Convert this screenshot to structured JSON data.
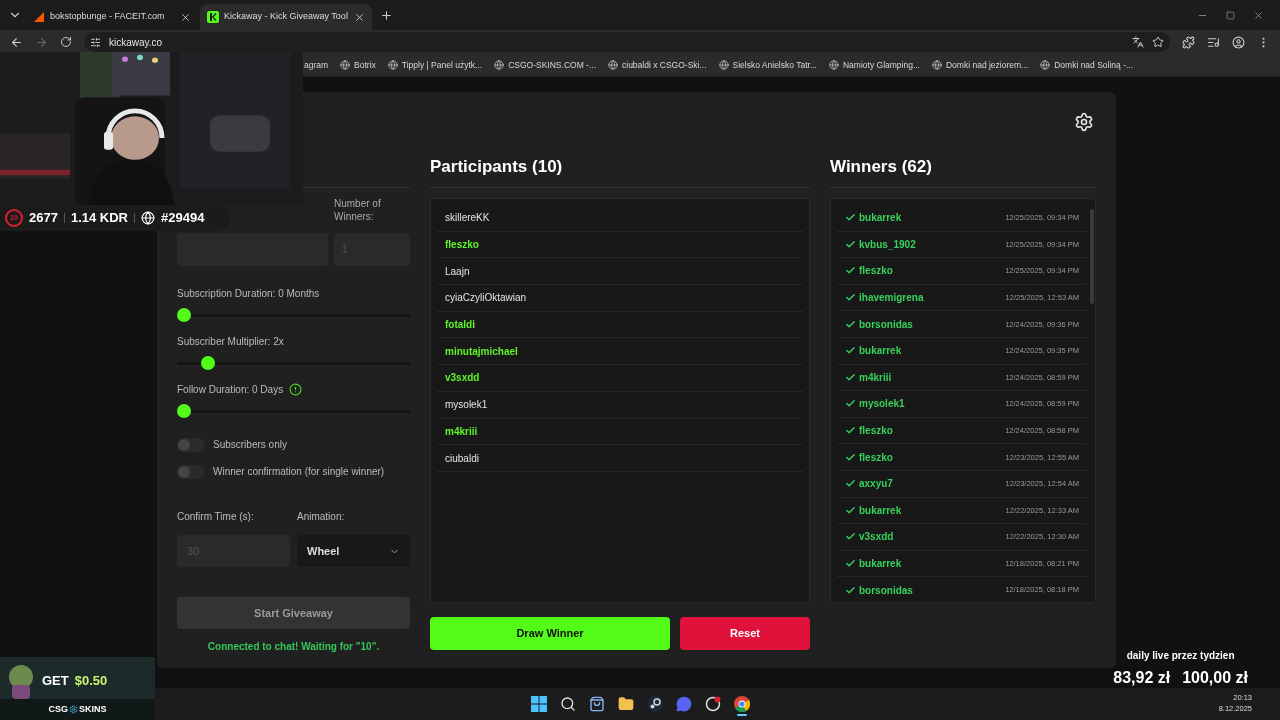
{
  "browser": {
    "tabs": [
      {
        "title": "bokstopbunge - FACEIT.com",
        "selected": false
      },
      {
        "title": "Kickaway - Kick Giveaway Tool",
        "selected": true
      }
    ],
    "url": "kickaway.co",
    "bookmarks": [
      "agram",
      "Botrix",
      "Tipply | Panel użytk...",
      "CSGO-SKINS.COM -...",
      "ciubaldi x CSGO-Ski...",
      "Sielsko Anielsko Tatr...",
      "Namioty Glamping...",
      "Domki nad jeziorem...",
      "Domki nad Soliną -..."
    ]
  },
  "settings": {
    "winners_label": "Number of Winners:",
    "winners_placeholder": "1",
    "sliders": [
      {
        "label": "Subscription Duration: 0 Months",
        "level": 0,
        "info": false
      },
      {
        "label": "Subscriber Multiplier: 2x",
        "level": 0.11,
        "info": false
      },
      {
        "label": "Follow Duration: 0 Days",
        "level": 0,
        "info": true
      }
    ],
    "toggles": [
      {
        "label": "Subscribers only",
        "on": false
      },
      {
        "label": "Winner confirmation (for single winner)",
        "on": false
      }
    ],
    "confirm_label": "Confirm Time (s):",
    "confirm_placeholder": "30",
    "animation_label": "Animation:",
    "animation_value": "Wheel",
    "start_button": {
      "label": "Start Giveaway",
      "disabled": true
    },
    "status": "Connected to chat! Waiting for \"10\"."
  },
  "participants": {
    "title": "Participants (10)",
    "items": [
      {
        "name": "skillereKK",
        "highlighted": false
      },
      {
        "name": "fleszko",
        "highlighted": true
      },
      {
        "name": "Laajn",
        "highlighted": false
      },
      {
        "name": "cyiaCzyliOktawian",
        "highlighted": false
      },
      {
        "name": "fotaldi",
        "highlighted": true
      },
      {
        "name": "minutajmichael",
        "highlighted": true
      },
      {
        "name": "v3sxdd",
        "highlighted": true
      },
      {
        "name": "mysolek1",
        "highlighted": false
      },
      {
        "name": "m4kriii",
        "highlighted": true
      },
      {
        "name": "ciubaldi",
        "highlighted": false
      }
    ]
  },
  "actions": {
    "draw": "Draw Winner",
    "reset": "Reset"
  },
  "winners": {
    "title": "Winners (62)",
    "items": [
      {
        "name": "bukarrek",
        "time": "12/25/2025, 09:34 PM"
      },
      {
        "name": "kvbus_1902",
        "time": "12/25/2025, 09:34 PM"
      },
      {
        "name": "fleszko",
        "time": "12/25/2025, 09:34 PM"
      },
      {
        "name": "ihavemigrena",
        "time": "12/25/2025, 12:53 AM"
      },
      {
        "name": "borsonidas",
        "time": "12/24/2025, 09:36 PM"
      },
      {
        "name": "bukarrek",
        "time": "12/24/2025, 09:35 PM"
      },
      {
        "name": "m4kriii",
        "time": "12/24/2025, 08:59 PM"
      },
      {
        "name": "mysolek1",
        "time": "12/24/2025, 08:59 PM"
      },
      {
        "name": "fleszko",
        "time": "12/24/2025, 08:58 PM"
      },
      {
        "name": "fleszko",
        "time": "12/23/2025, 12:55 AM"
      },
      {
        "name": "axxyu7",
        "time": "12/23/2025, 12:54 AM"
      },
      {
        "name": "bukarrek",
        "time": "12/22/2025, 12:33 AM"
      },
      {
        "name": "v3sxdd",
        "time": "12/22/2025, 12:30 AM"
      },
      {
        "name": "bukarrek",
        "time": "12/18/2025, 08:21 PM"
      },
      {
        "name": "borsonidas",
        "time": "12/18/2025, 08:18 PM"
      }
    ]
  },
  "stream_overlay": {
    "faceit_level": "10",
    "elo": "2677",
    "kdr": "1.14 KDR",
    "rank": "#29494",
    "ad": {
      "get": "GET",
      "amount": "$0.50",
      "brand_left": "CSG",
      "brand_right": "SKINS"
    },
    "goal": {
      "title": "daily live przez tydzien",
      "current": "83,92 zł",
      "target": "100,00 zł"
    }
  },
  "taskbar": {
    "apps": [
      {
        "kind": "windows",
        "active": false
      },
      {
        "kind": "search",
        "active": false
      },
      {
        "kind": "store",
        "active": false
      },
      {
        "kind": "folder",
        "active": false
      },
      {
        "kind": "steam",
        "active": false
      },
      {
        "kind": "discord",
        "active": false
      },
      {
        "kind": "app",
        "active": false
      },
      {
        "kind": "chrome",
        "active": true
      }
    ],
    "time": "20:13",
    "date": "8.12.2025"
  }
}
